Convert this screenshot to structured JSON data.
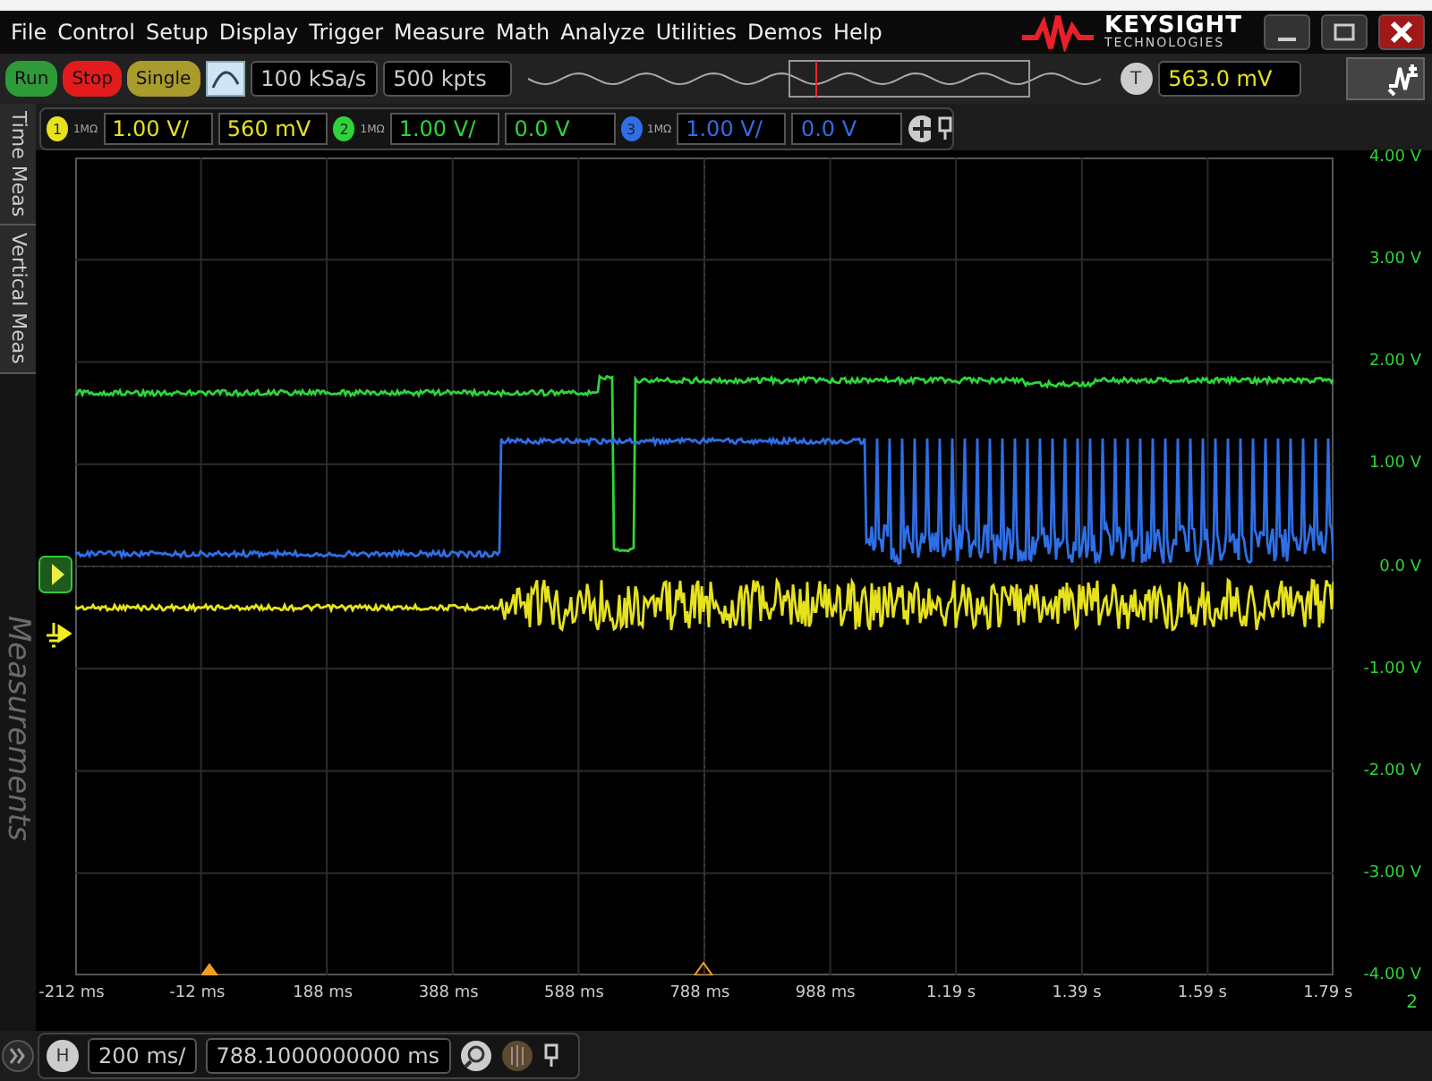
{
  "window": {
    "logo": "KEYSIGHT",
    "logo_subtitle": "TECHNOLOGIES"
  },
  "menu": [
    "File",
    "Control",
    "Setup",
    "Display",
    "Trigger",
    "Measure",
    "Math",
    "Analyze",
    "Utilities",
    "Demos",
    "Help"
  ],
  "run_controls": [
    {
      "label": "Run",
      "color": "#2f9a38"
    },
    {
      "label": "Stop",
      "color": "#e21c1c"
    },
    {
      "label": "Single",
      "color": "#a99b2c"
    }
  ],
  "acquisition": {
    "sample_rate": "100 kSa/s",
    "memory_depth": "500 kpts"
  },
  "trigger": {
    "badge": "T",
    "value": "563.0 mV"
  },
  "side_tabs": [
    "Time Meas",
    "Vertical Meas"
  ],
  "measurements_panel": {
    "title": "Measurements"
  },
  "channels": [
    {
      "number": "1",
      "impedance": "1MΩ",
      "scale": "1.00 V/",
      "offset": "560 mV",
      "color": "#e6e21e"
    },
    {
      "number": "2",
      "impedance": "1MΩ",
      "scale": "1.00 V/",
      "offset": "0.0 V",
      "color": "#2fd43a"
    },
    {
      "number": "3",
      "impedance": "1MΩ",
      "scale": "1.00 V/",
      "offset": "0.0 V",
      "color": "#2f6fe6"
    }
  ],
  "y_axis": {
    "labels": [
      "4.00 V",
      "3.00 V",
      "2.00 V",
      "1.00 V",
      "0.0 V",
      "-1.00 V",
      "-2.00 V",
      "-3.00 V",
      "-4.00 V"
    ]
  },
  "x_axis": {
    "labels": [
      "-212 ms",
      "-12 ms",
      "188 ms",
      "388 ms",
      "588 ms",
      "788 ms",
      "988 ms",
      "1.19 s",
      "1.39 s",
      "1.59 s",
      "1.79 s"
    ]
  },
  "channel_indicator": "2",
  "horizontal": {
    "badge": "H",
    "scale": "200 ms/",
    "position": "788.1000000000 ms"
  }
}
